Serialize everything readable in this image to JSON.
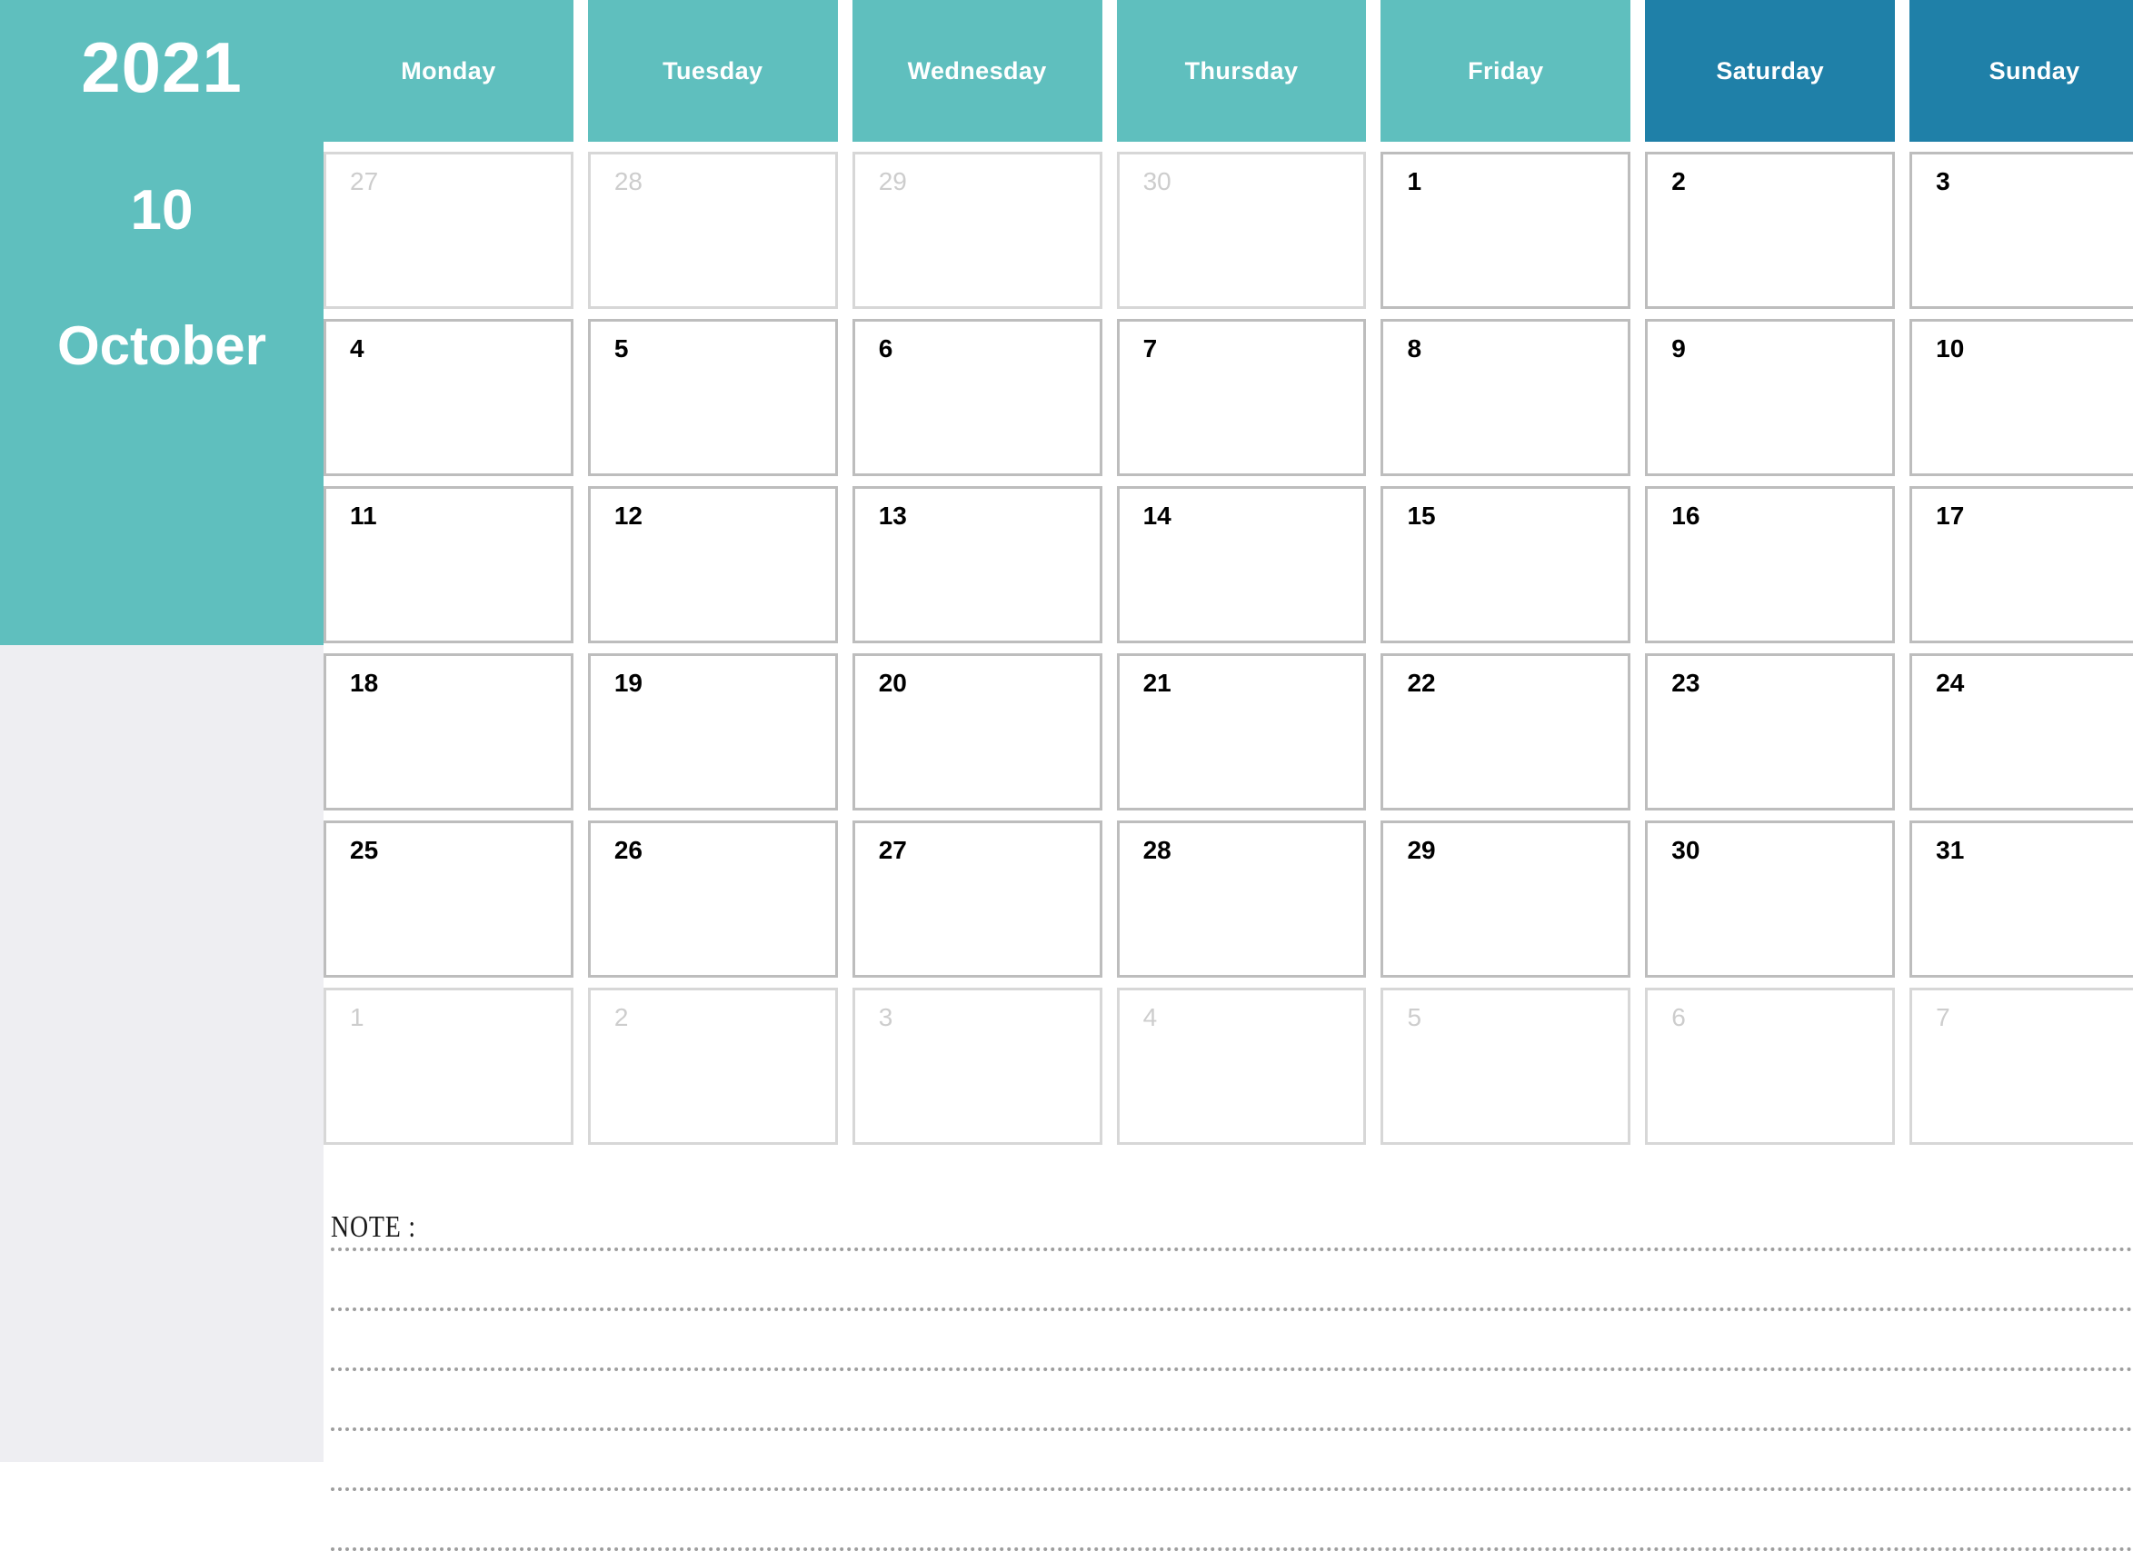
{
  "sidebar": {
    "year": "2021",
    "month_number": "10",
    "month_name": "October",
    "background_color": "#5fbfbe",
    "below_color": "#eeeef2"
  },
  "colors": {
    "weekday_header": "#5fbfbe",
    "weekend_header": "#1f80a8",
    "cell_border": "#bdbdbd",
    "muted_text": "#cdcdcd",
    "day_text": "#000000",
    "note_rule": "#9e9e9e"
  },
  "weekdays": [
    {
      "label": "Monday",
      "type": "weekday"
    },
    {
      "label": "Tuesday",
      "type": "weekday"
    },
    {
      "label": "Wednesday",
      "type": "weekday"
    },
    {
      "label": "Thursday",
      "type": "weekday"
    },
    {
      "label": "Friday",
      "type": "weekday"
    },
    {
      "label": "Saturday",
      "type": "weekend"
    },
    {
      "label": "Sunday",
      "type": "weekend"
    }
  ],
  "weeks": [
    [
      {
        "day": "27",
        "in_month": false
      },
      {
        "day": "28",
        "in_month": false
      },
      {
        "day": "29",
        "in_month": false
      },
      {
        "day": "30",
        "in_month": false
      },
      {
        "day": "1",
        "in_month": true
      },
      {
        "day": "2",
        "in_month": true
      },
      {
        "day": "3",
        "in_month": true
      }
    ],
    [
      {
        "day": "4",
        "in_month": true
      },
      {
        "day": "5",
        "in_month": true
      },
      {
        "day": "6",
        "in_month": true
      },
      {
        "day": "7",
        "in_month": true
      },
      {
        "day": "8",
        "in_month": true
      },
      {
        "day": "9",
        "in_month": true
      },
      {
        "day": "10",
        "in_month": true
      }
    ],
    [
      {
        "day": "11",
        "in_month": true
      },
      {
        "day": "12",
        "in_month": true
      },
      {
        "day": "13",
        "in_month": true
      },
      {
        "day": "14",
        "in_month": true
      },
      {
        "day": "15",
        "in_month": true
      },
      {
        "day": "16",
        "in_month": true
      },
      {
        "day": "17",
        "in_month": true
      }
    ],
    [
      {
        "day": "18",
        "in_month": true
      },
      {
        "day": "19",
        "in_month": true
      },
      {
        "day": "20",
        "in_month": true
      },
      {
        "day": "21",
        "in_month": true
      },
      {
        "day": "22",
        "in_month": true
      },
      {
        "day": "23",
        "in_month": true
      },
      {
        "day": "24",
        "in_month": true
      }
    ],
    [
      {
        "day": "25",
        "in_month": true
      },
      {
        "day": "26",
        "in_month": true
      },
      {
        "day": "27",
        "in_month": true
      },
      {
        "day": "28",
        "in_month": true
      },
      {
        "day": "29",
        "in_month": true
      },
      {
        "day": "30",
        "in_month": true
      },
      {
        "day": "31",
        "in_month": true
      }
    ],
    [
      {
        "day": "1",
        "in_month": false
      },
      {
        "day": "2",
        "in_month": false
      },
      {
        "day": "3",
        "in_month": false
      },
      {
        "day": "4",
        "in_month": false
      },
      {
        "day": "5",
        "in_month": false
      },
      {
        "day": "6",
        "in_month": false
      },
      {
        "day": "7",
        "in_month": false
      }
    ]
  ],
  "note": {
    "label": "NOTE :",
    "line_count": 6,
    "line_offsets": [
      52,
      118,
      184,
      250,
      316,
      382
    ]
  }
}
